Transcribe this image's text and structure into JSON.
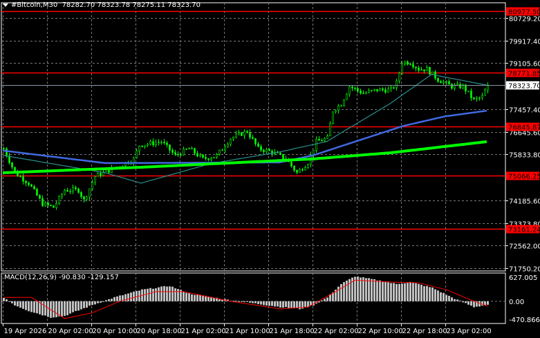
{
  "header": {
    "symbol": "#Bitcoin,M30",
    "ohlc": "78282.70 78323.78 78275.11 78323.70"
  },
  "macd": {
    "label": "MACD(12,26,9) -90.830 -129.157",
    "axis": [
      "627.005",
      "0.00",
      "-470.866"
    ]
  },
  "colors": {
    "candle": "#00ff00",
    "level": "#ff0000",
    "ma_fast": "#2a8f8f",
    "ma_mid": "#4169e1",
    "ma_slow": "#00ff00",
    "grid": "#7a7a7a",
    "hist": "#c0c0c0",
    "signal": "#ff0000"
  },
  "chart_data": {
    "type": "candlestick",
    "timeframe": "M30",
    "price_axis": [
      "80729.20",
      "79917.40",
      "79105.60",
      "77457.40",
      "76645.60",
      "75833.80",
      "74185.60",
      "73373.80",
      "72562.00",
      "71750.20"
    ],
    "ylim": [
      71750.2,
      80729.2
    ],
    "current_price": "78323.70",
    "levels": [
      "80977.50",
      "78771.85",
      "76845.87",
      "75066.25",
      "73161.24"
    ],
    "time_labels": [
      "19 Apr 2026",
      "20 Apr 02:00",
      "20 Apr 10:00",
      "20 Apr 18:00",
      "21 Apr 02:00",
      "21 Apr 10:00",
      "21 Apr 18:00",
      "22 Apr 02:00",
      "22 Apr 10:00",
      "22 Apr 18:00",
      "23 Apr 02:00"
    ],
    "bars_total": 176,
    "close_keypoints": [
      [
        0,
        76042
      ],
      [
        4,
        75174
      ],
      [
        9,
        74802
      ],
      [
        14,
        74058
      ],
      [
        18,
        73934
      ],
      [
        22,
        74554
      ],
      [
        27,
        74554
      ],
      [
        29,
        74182
      ],
      [
        33,
        75050
      ],
      [
        39,
        75298
      ],
      [
        47,
        75670
      ],
      [
        49,
        76166
      ],
      [
        57,
        76290
      ],
      [
        62,
        75794
      ],
      [
        67,
        76042
      ],
      [
        72,
        75670
      ],
      [
        77,
        75794
      ],
      [
        82,
        76414
      ],
      [
        88,
        76662
      ],
      [
        92,
        76042
      ],
      [
        97,
        75918
      ],
      [
        102,
        75670
      ],
      [
        106,
        75174
      ],
      [
        110,
        75546
      ],
      [
        113,
        76290
      ],
      [
        117,
        76414
      ],
      [
        119,
        77406
      ],
      [
        122,
        77654
      ],
      [
        125,
        78274
      ],
      [
        130,
        78026
      ],
      [
        135,
        78150
      ],
      [
        140,
        78150
      ],
      [
        142,
        78398
      ],
      [
        144,
        79142
      ],
      [
        147,
        79142
      ],
      [
        150,
        78894
      ],
      [
        153,
        78894
      ],
      [
        157,
        78522
      ],
      [
        162,
        78274
      ],
      [
        166,
        78274
      ],
      [
        170,
        77778
      ],
      [
        173,
        77902
      ],
      [
        175,
        78323.7
      ]
    ],
    "ma_fast_keypoints": [
      [
        0,
        75800
      ],
      [
        37,
        75174
      ],
      [
        50,
        74802
      ],
      [
        75,
        75500
      ],
      [
        100,
        75920
      ],
      [
        117,
        76290
      ],
      [
        140,
        77654
      ],
      [
        155,
        78700
      ],
      [
        175,
        78320
      ]
    ],
    "ma_mid_keypoints": [
      [
        0,
        75970
      ],
      [
        37,
        75522
      ],
      [
        100,
        75546
      ],
      [
        112,
        75794
      ],
      [
        145,
        76860
      ],
      [
        160,
        77200
      ],
      [
        175,
        77400
      ]
    ],
    "ma_slow_keypoints": [
      [
        0,
        75174
      ],
      [
        50,
        75372
      ],
      [
        112,
        75670
      ],
      [
        140,
        75890
      ],
      [
        175,
        76290
      ]
    ],
    "macd_hist_keypoints": [
      [
        0,
        100
      ],
      [
        4,
        -100
      ],
      [
        9,
        -250
      ],
      [
        17,
        -420
      ],
      [
        22,
        -380
      ],
      [
        32,
        -100
      ],
      [
        40,
        100
      ],
      [
        50,
        300
      ],
      [
        60,
        400
      ],
      [
        67,
        200
      ],
      [
        80,
        50
      ],
      [
        90,
        -50
      ],
      [
        100,
        -150
      ],
      [
        107,
        -200
      ],
      [
        112,
        -100
      ],
      [
        117,
        100
      ],
      [
        122,
        450
      ],
      [
        127,
        650
      ],
      [
        135,
        550
      ],
      [
        142,
        450
      ],
      [
        147,
        500
      ],
      [
        155,
        350
      ],
      [
        162,
        100
      ],
      [
        170,
        -150
      ],
      [
        175,
        -90.83
      ]
    ],
    "macd_signal_keypoints": [
      [
        0,
        100
      ],
      [
        10,
        100
      ],
      [
        22,
        -450
      ],
      [
        32,
        -300
      ],
      [
        42,
        0
      ],
      [
        55,
        250
      ],
      [
        65,
        250
      ],
      [
        82,
        0
      ],
      [
        100,
        -200
      ],
      [
        110,
        -150
      ],
      [
        120,
        250
      ],
      [
        127,
        550
      ],
      [
        140,
        500
      ],
      [
        150,
        480
      ],
      [
        160,
        300
      ],
      [
        170,
        0
      ],
      [
        175,
        -129.157
      ]
    ],
    "macd_ylim": [
      -470.866,
      627.005
    ]
  }
}
